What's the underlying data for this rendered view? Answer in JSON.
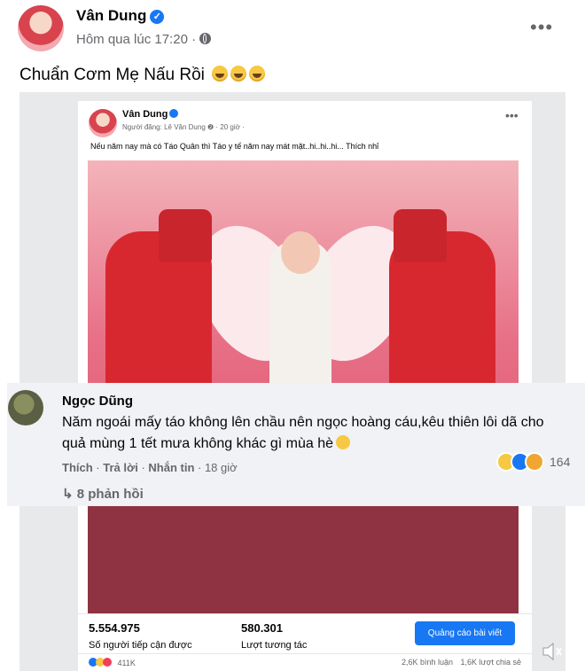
{
  "post": {
    "author": "Vân Dung",
    "time": "Hôm qua lúc 17:20 ·",
    "caption": "Chuẩn Cơm Mẹ Nấu Rồi",
    "more": "•••"
  },
  "embedded": {
    "author": "Vân Dung",
    "meta": "Người đăng: Lê Vân Dung ❷ · 20 giờ ·",
    "caption": "Nếu năm nay mà có Táo Quân thì Táo y tế năm nay mát mặt..hi..hi..hi...  Thích nhỉ",
    "more": "•••",
    "stats": {
      "reach_value": "5.554.975",
      "reach_label": "Số người tiếp cận được",
      "engagement_value": "580.301",
      "engagement_label": "Lượt tương tác",
      "ad_button": "Quảng cáo bài viết"
    },
    "reactions_count": "411K",
    "comments": "2,6K bình luận",
    "shares": "1,6K lượt chia sẻ"
  },
  "comment": {
    "name": "Ngọc Dũng",
    "text": "Năm ngoái mấy táo không lên chầu nên ngọc hoàng cáu,kêu thiên lôi dã cho quả mùng 1 tết mưa không khác gì mùa hè",
    "like": "Thích",
    "reply": "Trả lời",
    "message": "Nhắn tin",
    "time": "18 giờ",
    "reaction_count": "164",
    "replies": "8 phản hồi"
  },
  "colors": {
    "accent": "#1877f2",
    "secondary_text": "#65676b",
    "comment_bg": "#f0f2f5"
  },
  "icons": [
    "verified-badge-icon",
    "globe-icon",
    "more-icon",
    "laugh-emoji-icon",
    "reply-arrow-icon",
    "speaker-icon"
  ]
}
